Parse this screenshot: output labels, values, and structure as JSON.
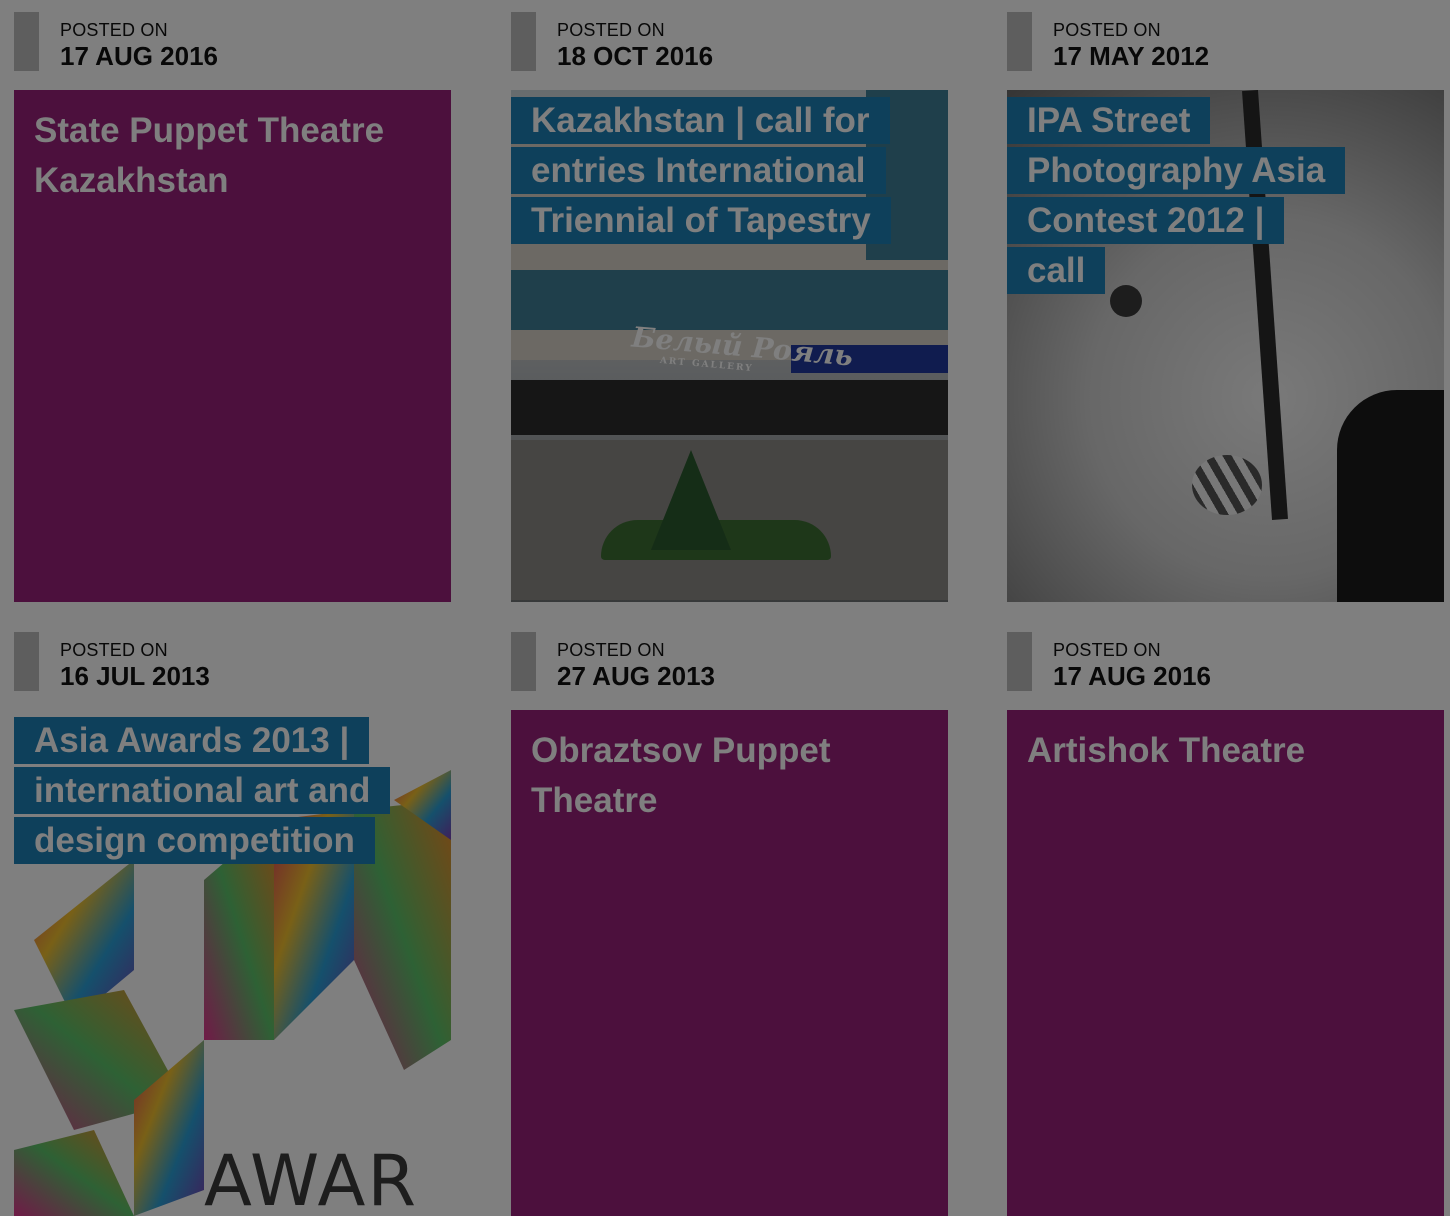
{
  "posts": [
    {
      "label": "POSTED ON",
      "date": "17 AUG 2016",
      "title": "State Puppet Theatre Kazakhstan",
      "style": "plain"
    },
    {
      "label": "POSTED ON",
      "date": "18 OCT 2016",
      "title": "Kazakhstan | call for entries International Triennial of Tapestry",
      "style": "photo-building",
      "photo_text": "Белый Рояль",
      "photo_subtext": "ART GALLERY"
    },
    {
      "label": "POSTED ON",
      "date": "17 MAY 2012",
      "title": "IPA Street Photography Asia Contest 2012 | call",
      "style": "photo-street"
    },
    {
      "label": "POSTED ON",
      "date": "16 JUL 2013",
      "title": "Asia Awards 2013 | international art and design competition",
      "style": "photo-awards",
      "photo_text": "AWAR"
    },
    {
      "label": "POSTED ON",
      "date": "27 AUG 2013",
      "title": "Obraztsov Puppet Theatre",
      "style": "plain"
    },
    {
      "label": "POSTED ON",
      "date": "17 AUG 2016",
      "title": "Artishok Theatre",
      "style": "plain"
    }
  ],
  "colors": {
    "plain_tile": "#98217b",
    "title_box": "#1c80b7",
    "overlay": "rgba(0,0,0,0.5)"
  }
}
